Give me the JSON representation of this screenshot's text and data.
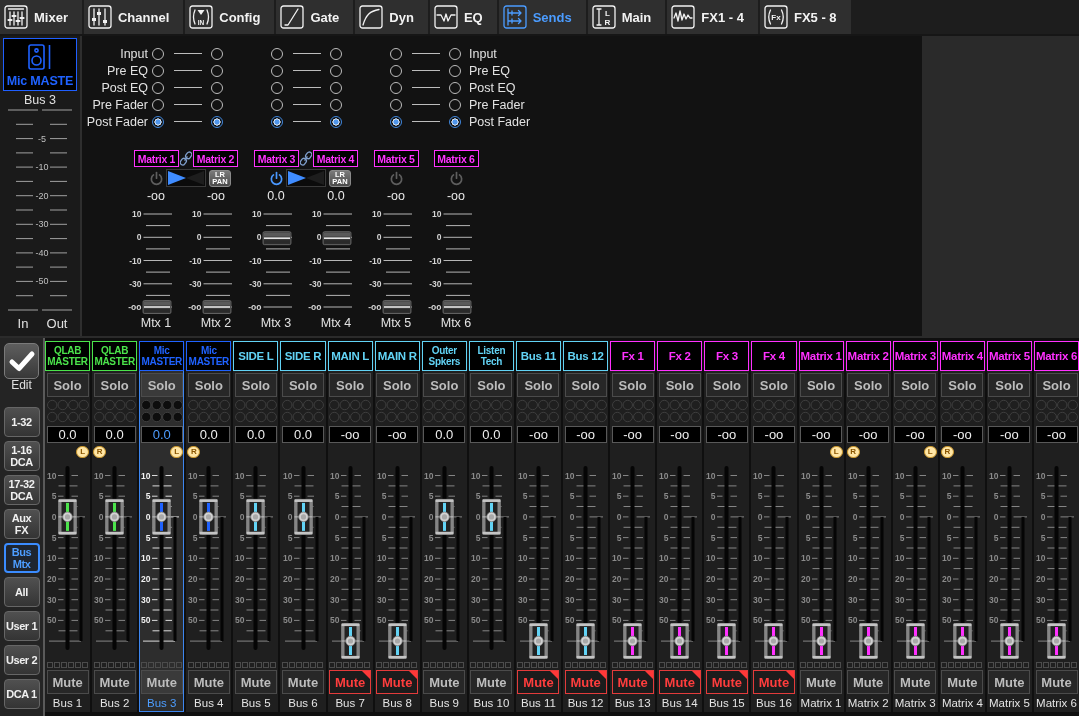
{
  "tabs": [
    {
      "label": "Mixer",
      "kind": "mixer",
      "selected": false
    },
    {
      "label": "Channel",
      "kind": "channel",
      "selected": false
    },
    {
      "label": "Config",
      "kind": "config",
      "icon_text": [
        "IN"
      ],
      "selected": false
    },
    {
      "label": "Gate",
      "kind": "gate",
      "selected": false
    },
    {
      "label": "Dyn",
      "kind": "dyn",
      "selected": false
    },
    {
      "label": "EQ",
      "kind": "eq",
      "selected": false
    },
    {
      "label": "Sends",
      "kind": "sends",
      "selected": true
    },
    {
      "label": "Main",
      "kind": "main",
      "icon_text": [
        "L",
        "R"
      ],
      "selected": false
    },
    {
      "label": "FX1 - 4",
      "kind": "fx",
      "selected": false
    },
    {
      "label": "FX5 - 8",
      "kind": "fx-rack",
      "icon_text": [
        "Fx"
      ],
      "selected": false
    }
  ],
  "channel": {
    "name": "Mic MASTE",
    "bus": "Bus 3",
    "meter_labels": [
      "-5",
      "-10",
      "-20",
      "-30",
      "-40",
      "-50"
    ],
    "meters": [
      "In",
      "Out"
    ]
  },
  "tap_points": [
    {
      "left_label": "Input",
      "right_label": "Input",
      "radios": [
        {
          "selected": false
        },
        {
          "selected": false
        },
        {
          "selected": false
        },
        {
          "selected": false
        },
        {
          "selected": false
        },
        {
          "selected": false
        }
      ]
    },
    {
      "left_label": "Pre EQ",
      "right_label": "Pre EQ",
      "radios": [
        {
          "selected": false
        },
        {
          "selected": false
        },
        {
          "selected": false
        },
        {
          "selected": false
        },
        {
          "selected": false
        },
        {
          "selected": false
        }
      ]
    },
    {
      "left_label": "Post EQ",
      "right_label": "Post EQ",
      "radios": [
        {
          "selected": false
        },
        {
          "selected": false
        },
        {
          "selected": false
        },
        {
          "selected": false
        },
        {
          "selected": false
        },
        {
          "selected": false
        }
      ]
    },
    {
      "left_label": "Pre Fader",
      "right_label": "Pre Fader",
      "radios": [
        {
          "selected": false
        },
        {
          "selected": false
        },
        {
          "selected": false
        },
        {
          "selected": false
        },
        {
          "selected": false
        },
        {
          "selected": false
        }
      ]
    },
    {
      "left_label": "Post Fader",
      "right_label": "Post Fader",
      "radios": [
        {
          "selected": true
        },
        {
          "selected": true
        },
        {
          "selected": true
        },
        {
          "selected": true
        },
        {
          "selected": true
        },
        {
          "selected": true
        }
      ]
    }
  ],
  "send_groups": [
    {
      "kind": "stereo",
      "on": false,
      "pan_button": "LR PAN",
      "sends": [
        {
          "label": "Matrix 1",
          "value": "-oo",
          "scale": [
            "10",
            "0",
            "-10",
            "-30",
            "-oo"
          ],
          "level": 0,
          "name": "Mtx 1"
        },
        {
          "label": "Matrix 2",
          "value": "-oo",
          "scale": [
            "10",
            "0",
            "-10",
            "-30",
            "-oo"
          ],
          "level": 0,
          "name": "Mtx 2"
        }
      ]
    },
    {
      "kind": "stereo",
      "on": true,
      "pan_button": "LR PAN",
      "sends": [
        {
          "label": "Matrix 3",
          "value": "0.0",
          "scale": [
            "10",
            "0",
            "-10",
            "-30",
            "-oo"
          ],
          "level": 0.74,
          "name": "Mtx 3"
        },
        {
          "label": "Matrix 4",
          "value": "0.0",
          "scale": [
            "10",
            "0",
            "-10",
            "-30",
            "-oo"
          ],
          "level": 0.74,
          "name": "Mtx 4"
        }
      ]
    },
    {
      "kind": "mono",
      "on": false,
      "sends": [
        {
          "label": "Matrix 5",
          "value": "-oo",
          "scale": [
            "10",
            "0",
            "-10",
            "-30",
            "-oo"
          ],
          "level": 0,
          "name": "Mtx 5"
        }
      ]
    },
    {
      "kind": "mono",
      "on": false,
      "sends": [
        {
          "label": "Matrix 6",
          "value": "-oo",
          "scale": [
            "10",
            "0",
            "-10",
            "-30",
            "-oo"
          ],
          "level": 0,
          "name": "Mtx 6"
        }
      ]
    }
  ],
  "side": {
    "edit": "Edit",
    "banks": [
      {
        "lines": [
          "1-32"
        ],
        "selected": false
      },
      {
        "lines": [
          "1-16",
          "DCA"
        ],
        "selected": false
      },
      {
        "lines": [
          "17-32",
          "DCA"
        ],
        "selected": false
      },
      {
        "lines": [
          "Aux",
          "FX"
        ],
        "selected": false
      },
      {
        "lines": [
          "Bus",
          "Mtx"
        ],
        "selected": true
      },
      {
        "lines": [
          "All"
        ],
        "selected": false
      },
      {
        "lines": [
          "User 1"
        ],
        "selected": false
      },
      {
        "lines": [
          "User 2"
        ],
        "selected": false
      },
      {
        "lines": [
          "DCA 1"
        ],
        "selected": false
      }
    ]
  },
  "strips": [
    {
      "name": [
        "QLAB",
        "MASTER"
      ],
      "color": "#4be34b",
      "solo": "Solo",
      "value": "0.0",
      "link_badge": {
        "kind": "left",
        "label": "L"
      },
      "scale": [
        "10",
        "5",
        "0",
        "5",
        "10",
        "20",
        "30",
        "50"
      ],
      "level": 0.75,
      "mute": "Mute",
      "muted": false,
      "label": "Bus 1",
      "selected": false
    },
    {
      "name": [
        "QLAB",
        "MASTER"
      ],
      "color": "#4be34b",
      "solo": "Solo",
      "value": "0.0",
      "link_badge": {
        "kind": "right",
        "label": "R"
      },
      "scale": [
        "10",
        "5",
        "0",
        "5",
        "10",
        "20",
        "30",
        "50"
      ],
      "level": 0.75,
      "mute": "Mute",
      "muted": false,
      "label": "Bus 2",
      "selected": false
    },
    {
      "name": [
        "Mic",
        "MASTER"
      ],
      "color": "#1f62ff",
      "solo": "Solo",
      "value": "0.0",
      "link_badge": {
        "kind": "left",
        "label": "L"
      },
      "scale": [
        "10",
        "5",
        "0",
        "5",
        "10",
        "20",
        "30",
        "50"
      ],
      "level": 0.75,
      "mute": "Mute",
      "muted": false,
      "label": "Bus 3",
      "selected": true
    },
    {
      "name": [
        "Mic",
        "MASTER"
      ],
      "color": "#1f62ff",
      "solo": "Solo",
      "value": "0.0",
      "link_badge": {
        "kind": "right",
        "label": "R"
      },
      "scale": [
        "10",
        "5",
        "0",
        "5",
        "10",
        "20",
        "30",
        "50"
      ],
      "level": 0.75,
      "mute": "Mute",
      "muted": false,
      "label": "Bus 4",
      "selected": false
    },
    {
      "name": [
        "SIDE L"
      ],
      "color": "#62d3f5",
      "solo": "Solo",
      "value": "0.0",
      "scale": [
        "10",
        "5",
        "0",
        "5",
        "10",
        "20",
        "30",
        "50"
      ],
      "level": 0.75,
      "mute": "Mute",
      "muted": false,
      "label": "Bus 5",
      "selected": false
    },
    {
      "name": [
        "SIDE R"
      ],
      "color": "#62d3f5",
      "solo": "Solo",
      "value": "0.0",
      "scale": [
        "10",
        "5",
        "0",
        "5",
        "10",
        "20",
        "30",
        "50"
      ],
      "level": 0.75,
      "mute": "Mute",
      "muted": false,
      "label": "Bus 6",
      "selected": false
    },
    {
      "name": [
        "MAIN L"
      ],
      "color": "#62d3f5",
      "solo": "Solo",
      "value": "-oo",
      "scale": [
        "10",
        "5",
        "0",
        "5",
        "10",
        "20",
        "30",
        "50"
      ],
      "level": 0,
      "mute": "Mute",
      "muted": true,
      "label": "Bus 7",
      "selected": false
    },
    {
      "name": [
        "MAIN R"
      ],
      "color": "#62d3f5",
      "solo": "Solo",
      "value": "-oo",
      "scale": [
        "10",
        "5",
        "0",
        "5",
        "10",
        "20",
        "30",
        "50"
      ],
      "level": 0,
      "mute": "Mute",
      "muted": true,
      "label": "Bus 8",
      "selected": false
    },
    {
      "name": [
        "Outer",
        "Spkers"
      ],
      "color": "#62d3f5",
      "solo": "Solo",
      "value": "0.0",
      "scale": [
        "10",
        "5",
        "0",
        "5",
        "10",
        "20",
        "30",
        "50"
      ],
      "level": 0.75,
      "mute": "Mute",
      "muted": false,
      "label": "Bus 9",
      "selected": false
    },
    {
      "name": [
        "Listen",
        "Tech"
      ],
      "color": "#62d3f5",
      "solo": "Solo",
      "value": "0.0",
      "scale": [
        "10",
        "5",
        "0",
        "5",
        "10",
        "20",
        "30",
        "50"
      ],
      "level": 0.75,
      "mute": "Mute",
      "muted": false,
      "label": "Bus 10",
      "selected": false
    },
    {
      "name": [
        "Bus 11"
      ],
      "color": "#62d3f5",
      "solo": "Solo",
      "value": "-oo",
      "scale": [
        "10",
        "5",
        "0",
        "5",
        "10",
        "20",
        "30",
        "50"
      ],
      "level": 0,
      "mute": "Mute",
      "muted": true,
      "label": "Bus 11",
      "selected": false
    },
    {
      "name": [
        "Bus 12"
      ],
      "color": "#62d3f5",
      "solo": "Solo",
      "value": "-oo",
      "scale": [
        "10",
        "5",
        "0",
        "5",
        "10",
        "20",
        "30",
        "50"
      ],
      "level": 0,
      "mute": "Mute",
      "muted": true,
      "label": "Bus 12",
      "selected": false
    },
    {
      "name": [
        "Fx 1"
      ],
      "color": "#ff30ff",
      "solo": "Solo",
      "value": "-oo",
      "scale": [
        "10",
        "5",
        "0",
        "5",
        "10",
        "20",
        "30",
        "50"
      ],
      "level": 0,
      "mute": "Mute",
      "muted": true,
      "label": "Bus 13",
      "selected": false
    },
    {
      "name": [
        "Fx 2"
      ],
      "color": "#ff30ff",
      "solo": "Solo",
      "value": "-oo",
      "scale": [
        "10",
        "5",
        "0",
        "5",
        "10",
        "20",
        "30",
        "50"
      ],
      "level": 0,
      "mute": "Mute",
      "muted": true,
      "label": "Bus 14",
      "selected": false
    },
    {
      "name": [
        "Fx 3"
      ],
      "color": "#ff30ff",
      "solo": "Solo",
      "value": "-oo",
      "scale": [
        "10",
        "5",
        "0",
        "5",
        "10",
        "20",
        "30",
        "50"
      ],
      "level": 0,
      "mute": "Mute",
      "muted": true,
      "label": "Bus 15",
      "selected": false
    },
    {
      "name": [
        "Fx 4"
      ],
      "color": "#ff30ff",
      "solo": "Solo",
      "value": "-oo",
      "scale": [
        "10",
        "5",
        "0",
        "5",
        "10",
        "20",
        "30",
        "50"
      ],
      "level": 0,
      "mute": "Mute",
      "muted": true,
      "label": "Bus 16",
      "selected": false
    },
    {
      "name": [
        "Matrix 1"
      ],
      "color": "#ff30ff",
      "solo": "Solo",
      "value": "-oo",
      "link_badge": {
        "kind": "left",
        "label": "L"
      },
      "scale": [
        "10",
        "5",
        "0",
        "5",
        "10",
        "20",
        "30",
        "50"
      ],
      "level": 0,
      "mute": "Mute",
      "muted": false,
      "label": "Matrix 1",
      "selected": false
    },
    {
      "name": [
        "Matrix 2"
      ],
      "color": "#ff30ff",
      "solo": "Solo",
      "value": "-oo",
      "link_badge": {
        "kind": "right",
        "label": "R"
      },
      "scale": [
        "10",
        "5",
        "0",
        "5",
        "10",
        "20",
        "30",
        "50"
      ],
      "level": 0,
      "mute": "Mute",
      "muted": false,
      "label": "Matrix 2",
      "selected": false
    },
    {
      "name": [
        "Matrix 3"
      ],
      "color": "#ff30ff",
      "solo": "Solo",
      "value": "-oo",
      "link_badge": {
        "kind": "left",
        "label": "L"
      },
      "scale": [
        "10",
        "5",
        "0",
        "5",
        "10",
        "20",
        "30",
        "50"
      ],
      "level": 0,
      "mute": "Mute",
      "muted": false,
      "label": "Matrix 3",
      "selected": false
    },
    {
      "name": [
        "Matrix 4"
      ],
      "color": "#ff30ff",
      "solo": "Solo",
      "value": "-oo",
      "link_badge": {
        "kind": "right",
        "label": "R"
      },
      "scale": [
        "10",
        "5",
        "0",
        "5",
        "10",
        "20",
        "30",
        "50"
      ],
      "level": 0,
      "mute": "Mute",
      "muted": false,
      "label": "Matrix 4",
      "selected": false
    },
    {
      "name": [
        "Matrix 5"
      ],
      "color": "#ff30ff",
      "solo": "Solo",
      "value": "-oo",
      "scale": [
        "10",
        "5",
        "0",
        "5",
        "10",
        "20",
        "30",
        "50"
      ],
      "level": 0,
      "mute": "Mute",
      "muted": false,
      "label": "Matrix 5",
      "selected": false
    },
    {
      "name": [
        "Matrix 6"
      ],
      "color": "#ff30ff",
      "solo": "Solo",
      "value": "-oo",
      "scale": [
        "10",
        "5",
        "0",
        "5",
        "10",
        "20",
        "30",
        "50"
      ],
      "level": 0,
      "mute": "Mute",
      "muted": false,
      "label": "Matrix 6",
      "selected": false
    }
  ]
}
